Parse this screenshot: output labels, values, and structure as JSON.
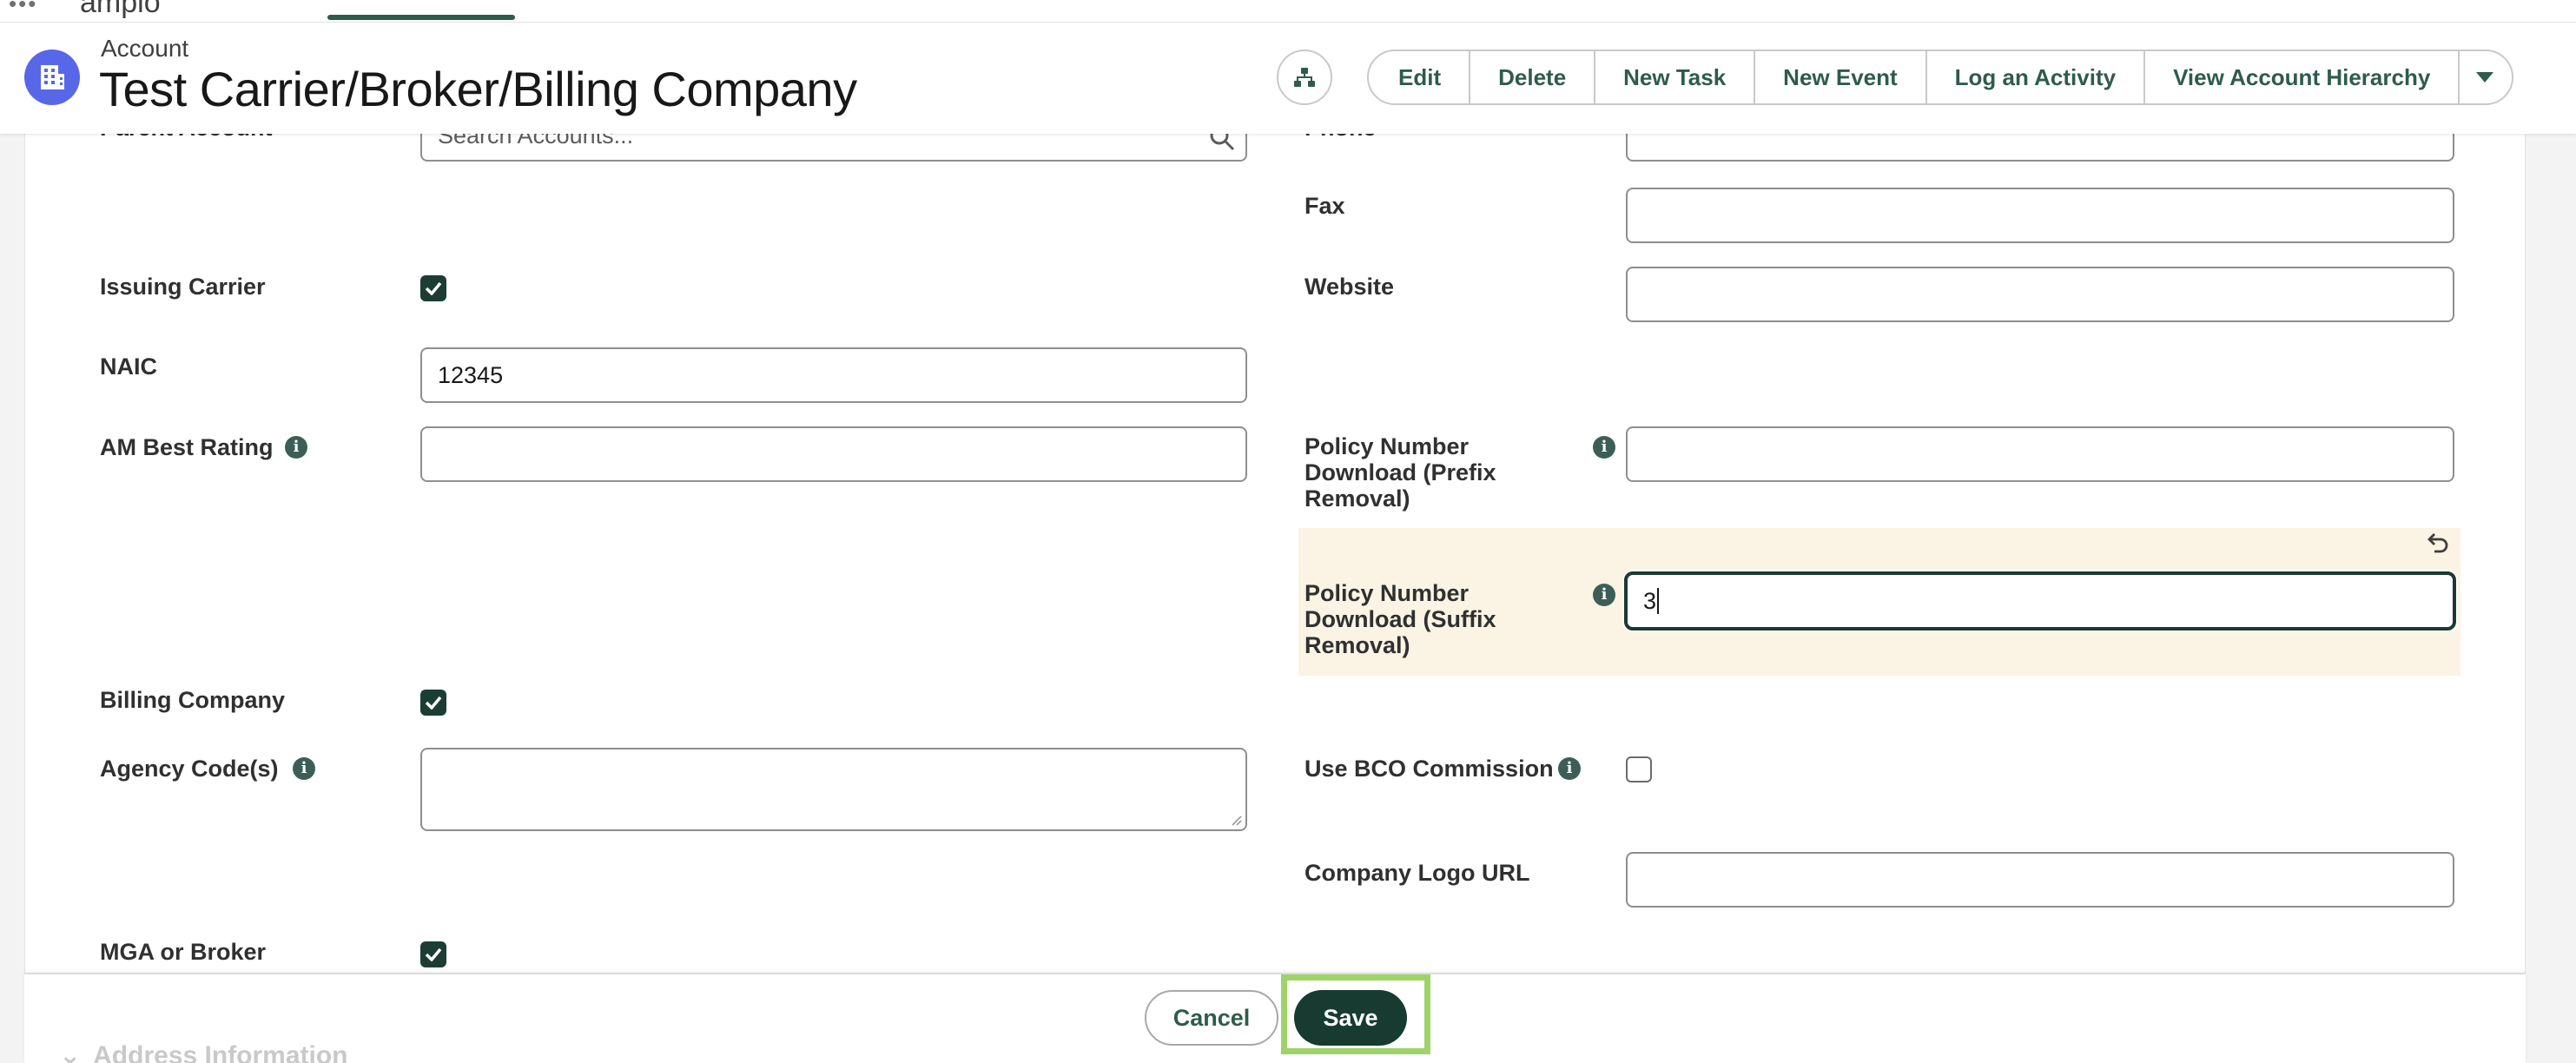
{
  "app": {
    "name": "ampio"
  },
  "header": {
    "object_type": "Account",
    "record_title": "Test Carrier/Broker/Billing Company",
    "actions": [
      "Edit",
      "Delete",
      "New Task",
      "New Event",
      "Log an Activity",
      "View Account Hierarchy"
    ],
    "hierarchy_icon": "hierarchy-icon",
    "more_icon": "chevron-down-icon",
    "record_icon": "building-icon",
    "accent_color": "#5867e8",
    "brand_color": "#2e5c4a"
  },
  "form": {
    "left": {
      "parent_account": {
        "label": "Parent Account",
        "placeholder": "Search Accounts..."
      },
      "issuing_carrier": {
        "label": "Issuing Carrier",
        "checked": true
      },
      "naic": {
        "label": "NAIC",
        "value": "12345"
      },
      "am_best_rating": {
        "label": "AM Best Rating",
        "value": ""
      },
      "billing_company": {
        "label": "Billing Company",
        "checked": true
      },
      "agency_codes": {
        "label": "Agency Code(s)",
        "value": ""
      },
      "mga_or_broker": {
        "label": "MGA or Broker",
        "checked": true
      }
    },
    "right": {
      "phone": {
        "label": "Phone",
        "value": ""
      },
      "fax": {
        "label": "Fax",
        "value": ""
      },
      "website": {
        "label": "Website",
        "value": ""
      },
      "policy_prefix": {
        "label_lines": [
          "Policy Number",
          "Download (Prefix",
          "Removal)"
        ],
        "value": ""
      },
      "policy_suffix": {
        "label_lines": [
          "Policy Number",
          "Download (Suffix",
          "Removal)"
        ],
        "value": "3",
        "edited": true
      },
      "use_bco_commission": {
        "label": "Use BCO Commission",
        "checked": false
      },
      "company_logo_url": {
        "label": "Company Logo URL",
        "value": ""
      }
    },
    "next_section": "Address Information"
  },
  "footer": {
    "cancel_label": "Cancel",
    "save_label": "Save",
    "save_highlight_color": "#9ed36a"
  }
}
